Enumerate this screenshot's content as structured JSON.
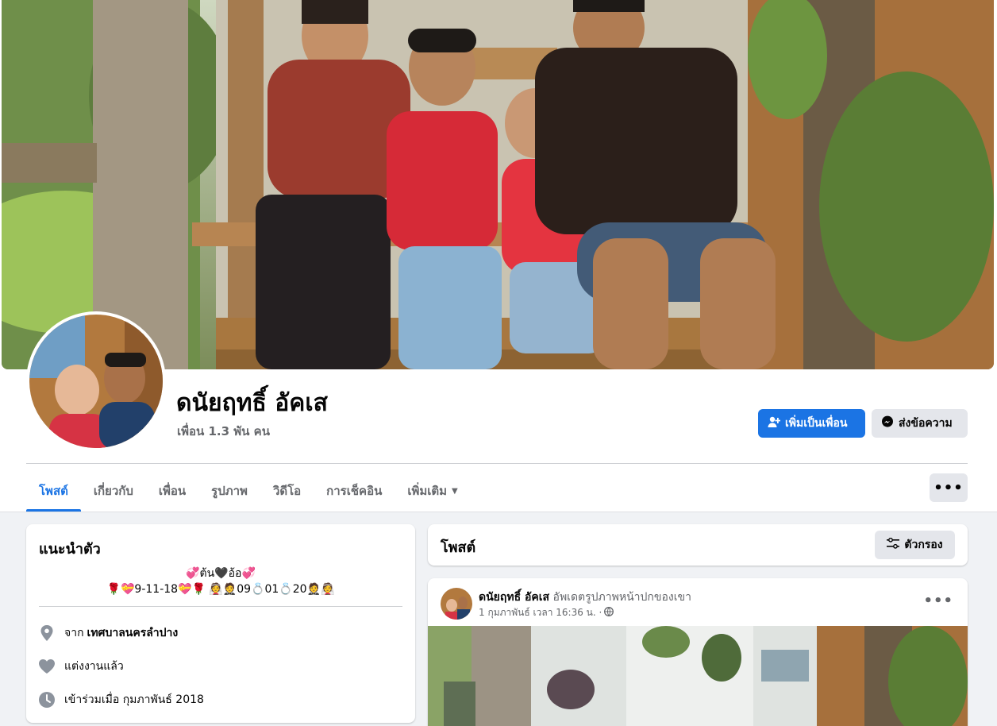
{
  "profile": {
    "name": "ดนัยฤทธิ์ อัคเส",
    "friends": "เพื่อน 1.3 พัน คน"
  },
  "actions": {
    "add_friend": "เพิ่มเป็นเพื่อน",
    "message": "ส่งข้อความ"
  },
  "tabs": [
    {
      "label": "โพสต์",
      "active": true
    },
    {
      "label": "เกี่ยวกับ",
      "active": false
    },
    {
      "label": "เพื่อน",
      "active": false
    },
    {
      "label": "รูปภาพ",
      "active": false
    },
    {
      "label": "วิดีโอ",
      "active": false
    },
    {
      "label": "การเช็คอิน",
      "active": false
    },
    {
      "label": "เพิ่มเติม",
      "active": false
    }
  ],
  "more_menu": "•••",
  "intro": {
    "title": "แนะนำตัว",
    "bio_line1": "💞ต้น🖤อ้อ💞",
    "bio_line2": "🌹💝9-11-18💝🌹 👰🤵09💍01💍20🤵👰",
    "from_prefix": "จาก",
    "from_place": "เทศบาลนครลำปาง",
    "relationship": "แต่งงานแล้ว",
    "joined": "เข้าร่วมเมื่อ กุมภาพันธ์ 2018"
  },
  "posts_section": {
    "title": "โพสต์",
    "filter_label": "ตัวกรอง"
  },
  "post": {
    "author": "ดนัยฤทธิ์ อัคเส",
    "action": "อัพเดตรูปภาพหน้าปกของเขา",
    "time": "1 กุมภาพันธ์ เวลา 16:36 น. ·",
    "more": "•••"
  },
  "colors": {
    "accent": "#1b74e4",
    "page_bg": "#f0f2f5",
    "secondary_btn": "#e4e6eb",
    "muted_text": "#65676b"
  },
  "icons": [
    "add-friend-icon",
    "messenger-icon",
    "location-icon",
    "heart-icon",
    "clock-icon",
    "filter-icon",
    "globe-icon",
    "more-icon",
    "caret-down-icon"
  ]
}
